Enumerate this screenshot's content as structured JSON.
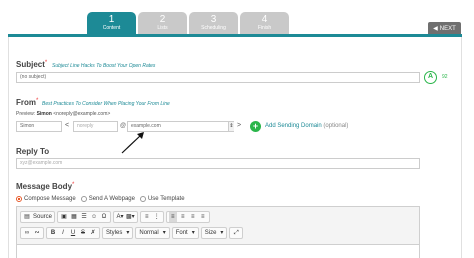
{
  "steps": [
    {
      "num": "1",
      "label": "Content",
      "active": true
    },
    {
      "num": "2",
      "label": "Lists",
      "active": false
    },
    {
      "num": "3",
      "label": "Scheduling",
      "active": false
    },
    {
      "num": "4",
      "label": "Finish",
      "active": false
    }
  ],
  "next_label": "NEXT",
  "subject": {
    "title": "Subject",
    "req": "*",
    "help": "Subject Line Hacks To Boost Your Open Rates",
    "value": "(no subject)",
    "grade": "A",
    "score": "92"
  },
  "from": {
    "title": "From",
    "req": "*",
    "help": "Best Practices To Consider When Placing Your From Line",
    "preview_label": "Preview:",
    "preview_name": "Simon",
    "preview_email": "<noreply@example.com>",
    "name_value": "Simon",
    "lt": "<",
    "user_placeholder": "noreply",
    "at": "@",
    "domain_value": "example.com",
    "gt": ">",
    "add_domain": "Add Sending Domain",
    "optional": "(optional)"
  },
  "reply_to": {
    "title": "Reply To",
    "placeholder": "xyz@example.com"
  },
  "message_body": {
    "title": "Message Body",
    "req": "*",
    "options": [
      {
        "label": "Compose Message",
        "selected": true
      },
      {
        "label": "Send A Webpage",
        "selected": false
      },
      {
        "label": "Use Template",
        "selected": false
      }
    ]
  },
  "toolbar": {
    "source": "Source",
    "styles": "Styles",
    "format": "Normal",
    "font": "Font",
    "size": "Size"
  }
}
